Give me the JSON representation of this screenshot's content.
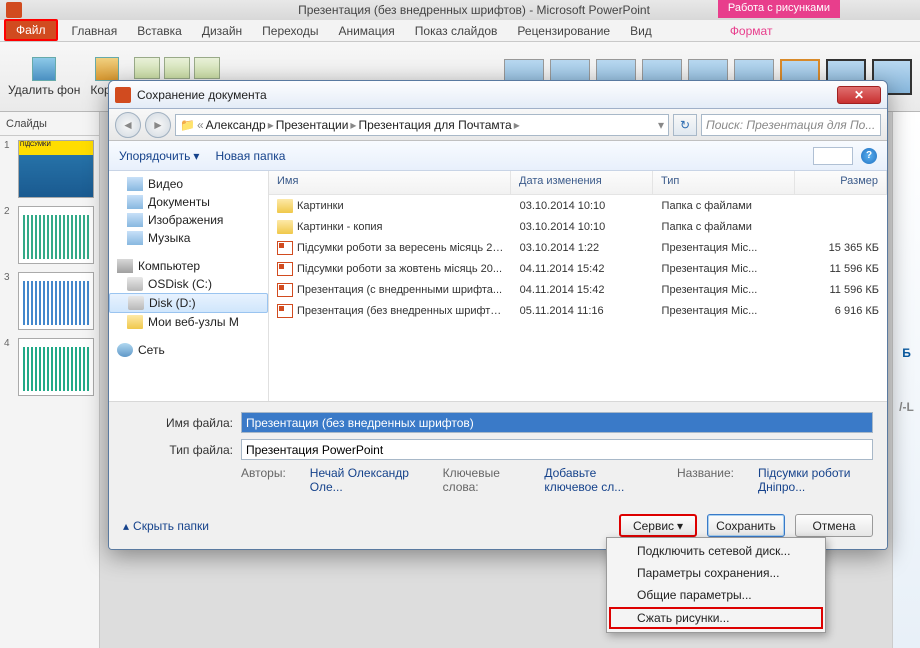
{
  "app": {
    "title": "Презентация (без внедренных шрифтов)  -  Microsoft PowerPoint",
    "tools_tab": "Работа с рисунками"
  },
  "ribbon_tabs": {
    "file": "Файл",
    "home": "Главная",
    "insert": "Вставка",
    "design": "Дизайн",
    "transitions": "Переходы",
    "animation": "Анимация",
    "slideshow": "Показ слайдов",
    "review": "Рецензирование",
    "view": "Вид",
    "format": "Формат"
  },
  "ribbon": {
    "remove_bg": "Удалить фон",
    "corrections": "Корре",
    "compress": "Сжать рисунки"
  },
  "slides_panel": {
    "header": "Слайды",
    "slide1_title": "ПІДСУМКИ"
  },
  "dialog": {
    "title": "Сохранение документа",
    "breadcrumb": {
      "p1": "Александр",
      "p2": "Презентации",
      "p3": "Презентация для Почтамта"
    },
    "search_placeholder": "Поиск: Презентация для По...",
    "toolbar": {
      "organize": "Упорядочить",
      "new_folder": "Новая папка"
    },
    "tree": {
      "video": "Видео",
      "documents": "Документы",
      "images": "Изображения",
      "music": "Музыка",
      "computer": "Компьютер",
      "osdisk": "OSDisk (C:)",
      "diskd": "Disk (D:)",
      "webnodes": "Мои веб-узлы M",
      "network": "Сеть"
    },
    "columns": {
      "name": "Имя",
      "date": "Дата изменения",
      "type": "Тип",
      "size": "Размер"
    },
    "rows": [
      {
        "name": "Картинки",
        "date": "03.10.2014 10:10",
        "type": "Папка с файлами",
        "size": "",
        "icon": "folder"
      },
      {
        "name": "Картинки - копия",
        "date": "03.10.2014 10:10",
        "type": "Папка с файлами",
        "size": "",
        "icon": "folder"
      },
      {
        "name": "Підсумки роботи за вересень місяць 20...",
        "date": "03.10.2014 1:22",
        "type": "Презентация Mic...",
        "size": "15 365 КБ",
        "icon": "ppt"
      },
      {
        "name": "Підсумки роботи за жовтень місяць 20...",
        "date": "04.11.2014 15:42",
        "type": "Презентация Mic...",
        "size": "11 596 КБ",
        "icon": "ppt"
      },
      {
        "name": "Презентация (с внедренными шрифта...",
        "date": "04.11.2014 15:42",
        "type": "Презентация Mic...",
        "size": "11 596 КБ",
        "icon": "ppt"
      },
      {
        "name": "Презентация (без внедренных шрифтов)",
        "date": "05.11.2014 11:16",
        "type": "Презентация Mic...",
        "size": "6 916 КБ",
        "icon": "ppt"
      }
    ],
    "filename_label": "Имя файла:",
    "filename_value": "Презентация (без внедренных шрифтов)",
    "filetype_label": "Тип файла:",
    "filetype_value": "Презентация PowerPoint",
    "meta": {
      "authors_lbl": "Авторы:",
      "authors_val": "Нечай Олександр Оле...",
      "keywords_lbl": "Ключевые слова:",
      "keywords_val": "Добавьте ключевое сл...",
      "title_lbl": "Название:",
      "title_val": "Підсумки роботи Дніпро..."
    },
    "hide_folders": "Скрыть папки",
    "buttons": {
      "tools": "Сервис",
      "save": "Сохранить",
      "cancel": "Отмена"
    },
    "tools_menu": {
      "map_drive": "Подключить сетевой диск...",
      "save_options": "Параметры сохранения...",
      "general": "Общие параметры...",
      "compress": "Сжать рисунки..."
    }
  }
}
